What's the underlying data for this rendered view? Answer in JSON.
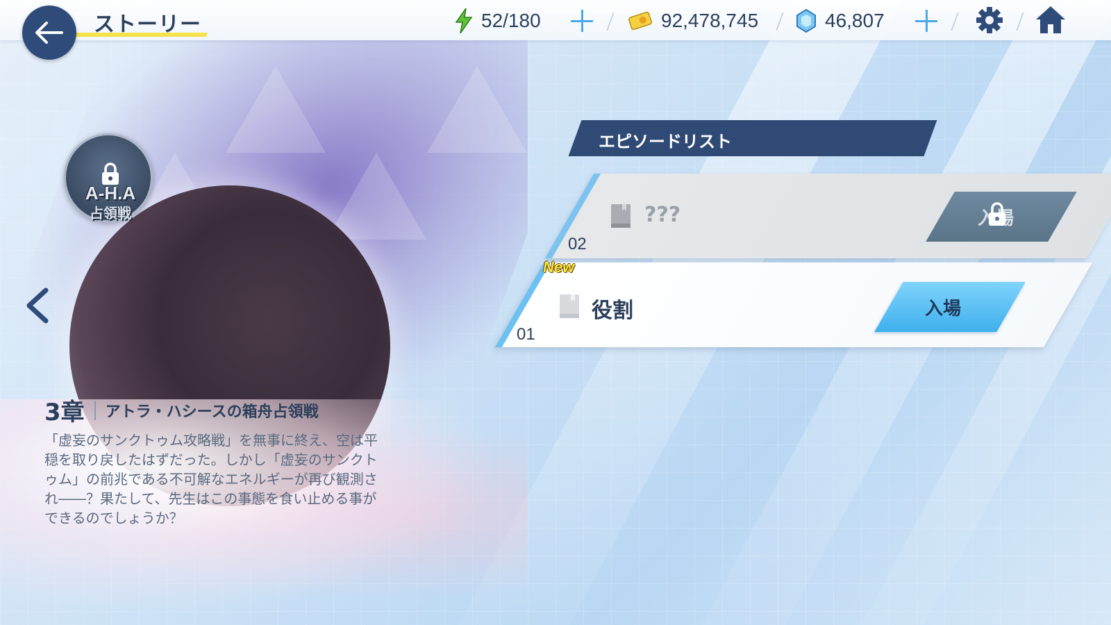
{
  "topbar": {
    "title": "ストーリー",
    "stamina": "52/180",
    "credits": "92,478,745",
    "gems": "46,807"
  },
  "chapter": {
    "emblem_title": "A-H.A",
    "emblem_sub": "占領戦",
    "number": "3章",
    "title": "アトラ・ハシースの箱舟占領戦",
    "description": "「虚妄のサンクトゥム攻略戦」を無事に終え、空は平穏を取り戻したはずだった。しかし「虚妄のサンクトゥム」の前兆である不可解なエネルギーが再び観測され――？果たして、先生はこの事態を食い止める事ができるのでしょうか？"
  },
  "episode_list": {
    "header": "エピソードリスト",
    "episodes": [
      {
        "number": "02",
        "name": "???",
        "button": "入場",
        "locked": true
      },
      {
        "number": "01",
        "name": "役割",
        "button": "入場",
        "locked": false,
        "badge": "New"
      }
    ]
  },
  "colors": {
    "header_navy": "#2f4b75",
    "accent_blue": "#3fb0ee",
    "title_underline": "#f5e24a"
  }
}
